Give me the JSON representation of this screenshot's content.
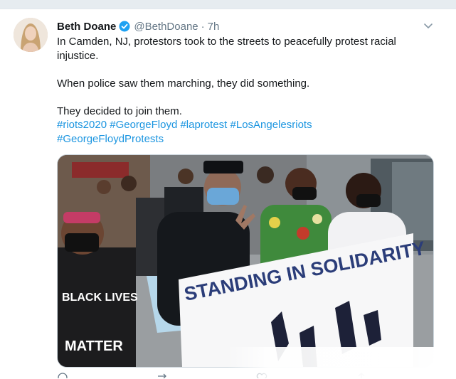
{
  "tweet": {
    "author": {
      "name": "Beth Doane",
      "handle": "@BethDoane",
      "separator": "·",
      "time": "7h",
      "avatar_icon": "avatar-photo"
    },
    "text": {
      "line1": "In Camden, NJ, protestors took to the streets to peacefully protest racial injustice.",
      "line2": "When police saw them marching, they did something.",
      "line3": "They decided to join them.",
      "hashtags": [
        "#riots2020",
        "#GeorgeFloyd",
        "#laprotest",
        "#LosAngelesriots",
        "#GeorgeFloydProtests"
      ]
    },
    "media": {
      "banner_text": "STANDING IN SOLIDARITY",
      "shirt_text_1": "BLACK LIVES",
      "shirt_text_2": "MATTER"
    },
    "colors": {
      "link": "#1b95e0",
      "muted": "#657786",
      "verified": "#1da1f2"
    }
  }
}
